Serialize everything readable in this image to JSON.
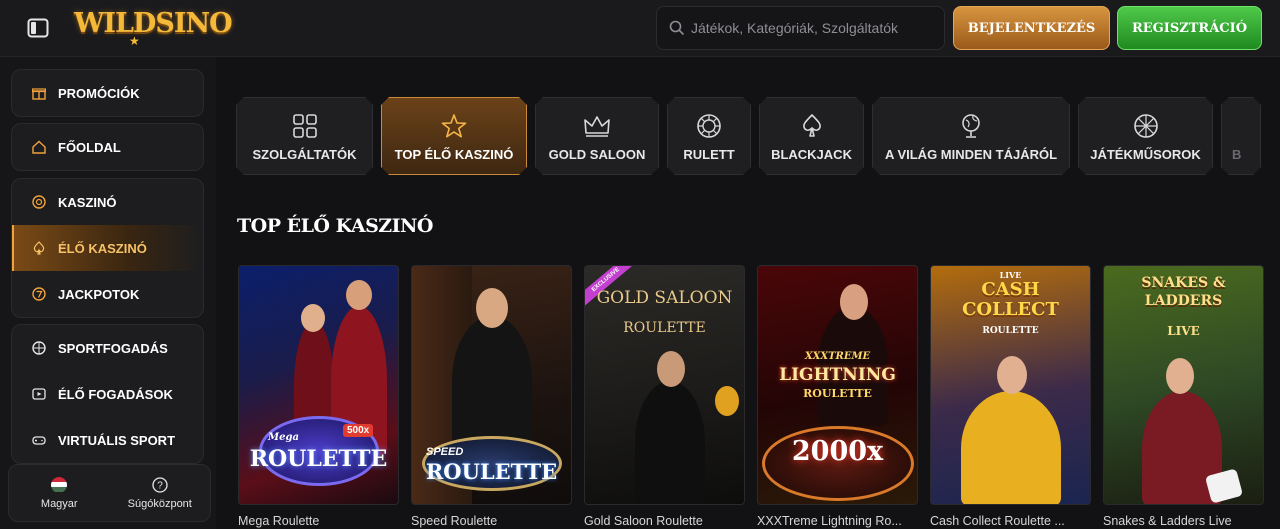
{
  "header": {
    "logo_text": "WILDSINO",
    "search_placeholder": "Játékok, Kategóriák, Szolgáltatók",
    "login_label": "BEJELENTKEZÉS",
    "register_label": "REGISZTRÁCIÓ"
  },
  "sidebar": {
    "promo": "PROMÓCIÓK",
    "home": "FŐOLDAL",
    "casino": "KASZINÓ",
    "live_casino": "ÉLŐ KASZINÓ",
    "jackpots": "JACKPOTOK",
    "sports": "SPORTFOGADÁS",
    "live_bets": "ÉLŐ FOGADÁSOK",
    "virtual": "VIRTUÁLIS SPORT",
    "language": "Magyar",
    "help": "Súgóközpont"
  },
  "categories": [
    {
      "label": "SZOLGÁLTATÓK",
      "icon": "grid-icon"
    },
    {
      "label": "TOP ÉLŐ KASZINÓ",
      "icon": "star-icon"
    },
    {
      "label": "GOLD SALOON",
      "icon": "crown-icon"
    },
    {
      "label": "RULETT",
      "icon": "roulette-icon"
    },
    {
      "label": "BLACKJACK",
      "icon": "spade-icon"
    },
    {
      "label": "A VILÁG MINDEN TÁJÁRÓL",
      "icon": "globe-icon"
    },
    {
      "label": "JÁTÉKMŰSOROK",
      "icon": "wheel-icon"
    },
    {
      "label": "B",
      "icon": ""
    }
  ],
  "section_title": "TOP ÉLŐ KASZINÓ",
  "games": [
    {
      "name": "Mega Roulette",
      "art_title": "ROULETTE",
      "art_sub": "Mega",
      "badge": "500x"
    },
    {
      "name": "Speed Roulette",
      "art_title": "ROULETTE",
      "art_sub": "SPEED"
    },
    {
      "name": "Gold Saloon Roulette",
      "art_title": "GOLD SALOON",
      "art_sub": "ROULETTE",
      "badge": "EXCLUSIVE"
    },
    {
      "name": "XXXTreme Lightning Ro...",
      "art_title": "LIGHTNING",
      "art_sub": "XXXTREME",
      "art_sub2": "ROULETTE",
      "badge": "2000x"
    },
    {
      "name": "Cash Collect Roulette ...",
      "art_title": "CASH COLLECT",
      "art_sub": "ROULETTE",
      "art_sub2": "LIVE"
    },
    {
      "name": "Snakes & Ladders Live",
      "art_title": "SNAKES & LADDERS",
      "art_sub": "LIVE"
    }
  ],
  "colors": {
    "accent_gold": "#f5b93a",
    "register_green": "#2fa52c",
    "active_brown": "#6b4219"
  }
}
